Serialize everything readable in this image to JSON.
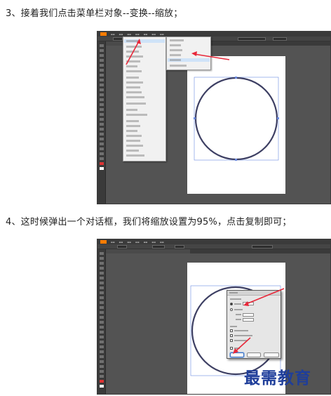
{
  "steps": [
    {
      "text": "3、接着我们点击菜单栏对象--变换--缩放；"
    },
    {
      "text": "4、这时候弹出一个对话框，我们将缩放设置为95%，点击复制即可；"
    }
  ],
  "watermark": "最需教育",
  "colors": {
    "workspace": "#535353",
    "panel": "#3a3a3a",
    "circle_stroke": "#3d3f63",
    "selection": "#6c8be0",
    "arrow": "#e8283a",
    "watermark": "#1f3e9a"
  }
}
